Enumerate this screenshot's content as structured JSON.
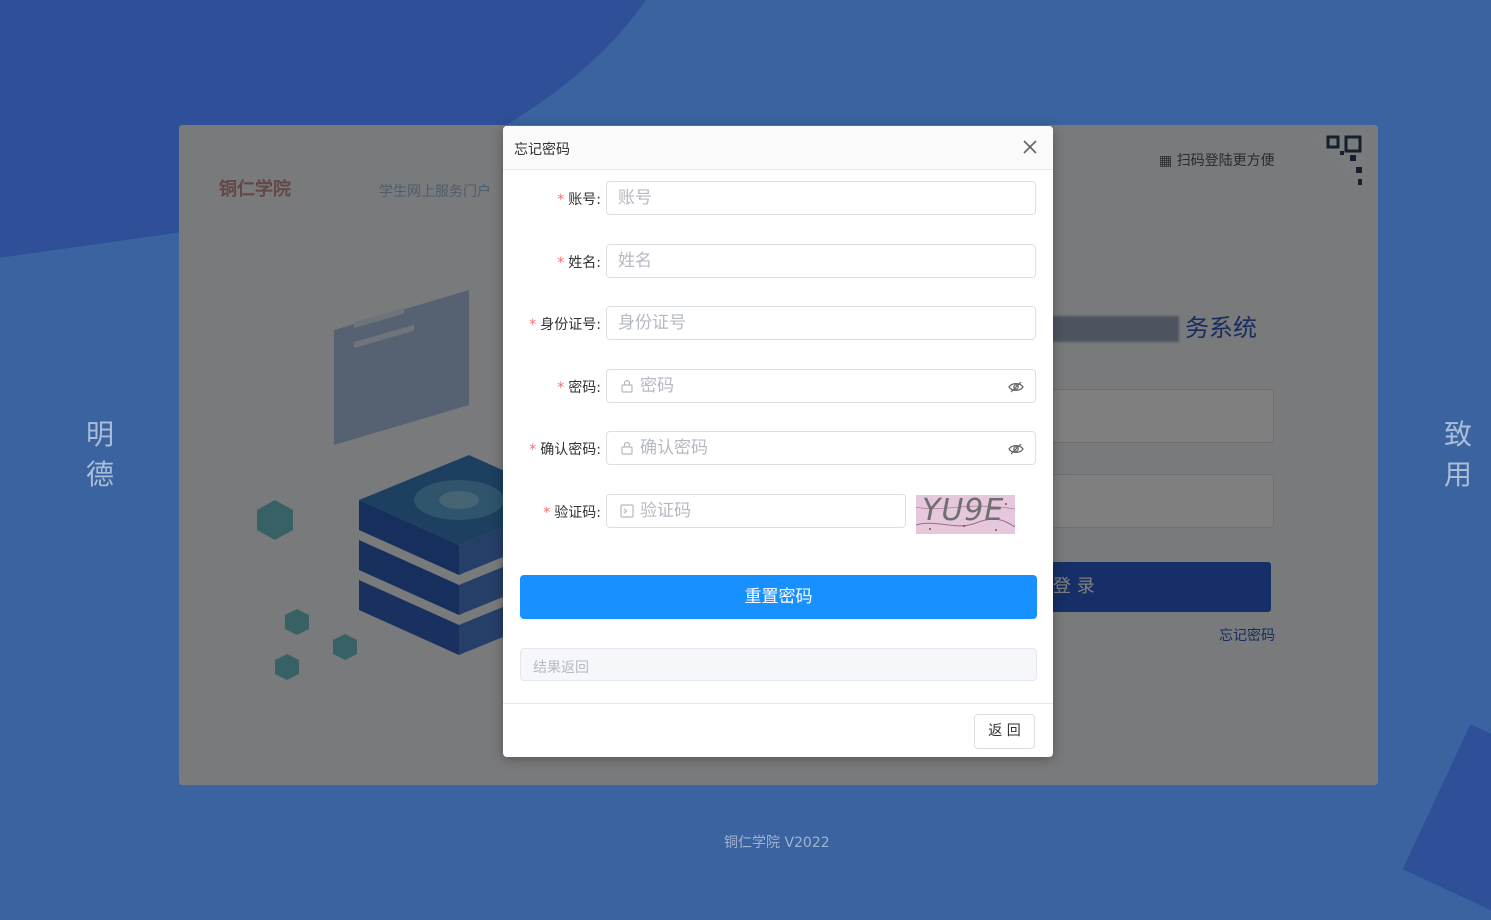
{
  "background": {
    "left_motto": "明德",
    "right_motto": "致用",
    "footer_version": "铜仁学院 V2022"
  },
  "login_page": {
    "logo_text": "铜仁学院",
    "logo_subtitle": "学生网上服务门户",
    "scan_tip": "扫码登陆更方便",
    "system_title_visible": "务系统",
    "login_button": "登 录",
    "forgot_link": "忘记密码"
  },
  "dialog": {
    "title": "忘记密码",
    "fields": {
      "account": {
        "label": "账号:",
        "placeholder": "账号",
        "value": ""
      },
      "name": {
        "label": "姓名:",
        "placeholder": "姓名",
        "value": ""
      },
      "id_number": {
        "label": "身份证号:",
        "placeholder": "身份证号",
        "value": ""
      },
      "password": {
        "label": "密码:",
        "placeholder": "密码",
        "value": ""
      },
      "confirm_password": {
        "label": "确认密码:",
        "placeholder": "确认密码",
        "value": ""
      },
      "captcha": {
        "label": "验证码:",
        "placeholder": "验证码",
        "value": ""
      }
    },
    "captcha_image_text": "YU9E",
    "reset_button": "重置密码",
    "result_placeholder": "结果返回",
    "back_button": "返 回"
  },
  "colors": {
    "primary": "#1890ff",
    "required_mark": "#f56c6c",
    "page_background": "#3a63a0"
  }
}
